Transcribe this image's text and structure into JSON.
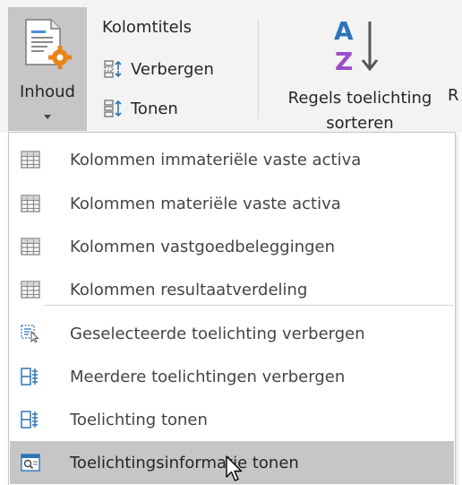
{
  "ribbon": {
    "inhoud": {
      "label": "Inhoud",
      "icon": "document-settings-icon"
    },
    "kolom_group": {
      "title": "Kolomtitels",
      "hide_label": "Verbergen",
      "show_label": "Tonen"
    },
    "sort": {
      "label_line1": "Regels toelichting",
      "label_line2": "sorteren",
      "icon": "sort-az-icon"
    },
    "cut_label": "R"
  },
  "menu": {
    "items": [
      {
        "label": "Kolommen immateriële vaste activa",
        "icon": "table-grid-icon"
      },
      {
        "label": "Kolommen materiële vaste activa",
        "icon": "table-grid-icon"
      },
      {
        "label": "Kolommen vastgoedbeleggingen",
        "icon": "table-grid-icon"
      },
      {
        "label": "Kolommen resultaatverdeling",
        "icon": "table-grid-icon"
      },
      {
        "label": "Geselecteerde toelichting verbergen",
        "icon": "selection-cursor-icon"
      },
      {
        "label": "Meerdere toelichtingen verbergen",
        "icon": "multi-hide-icon"
      },
      {
        "label": "Toelichting tonen",
        "icon": "show-note-icon"
      },
      {
        "label": "Toelichtingsinformatie tonen",
        "icon": "info-window-icon"
      }
    ],
    "hovered_index": 7
  },
  "colors": {
    "ribbon_bg": "#f3f3f3",
    "pressed_bg": "#c6c6c6",
    "hover_bg": "#c6c6c6",
    "accent_orange": "#e8841a",
    "accent_blue": "#2e75b6",
    "accent_purple": "#9b4dca"
  }
}
